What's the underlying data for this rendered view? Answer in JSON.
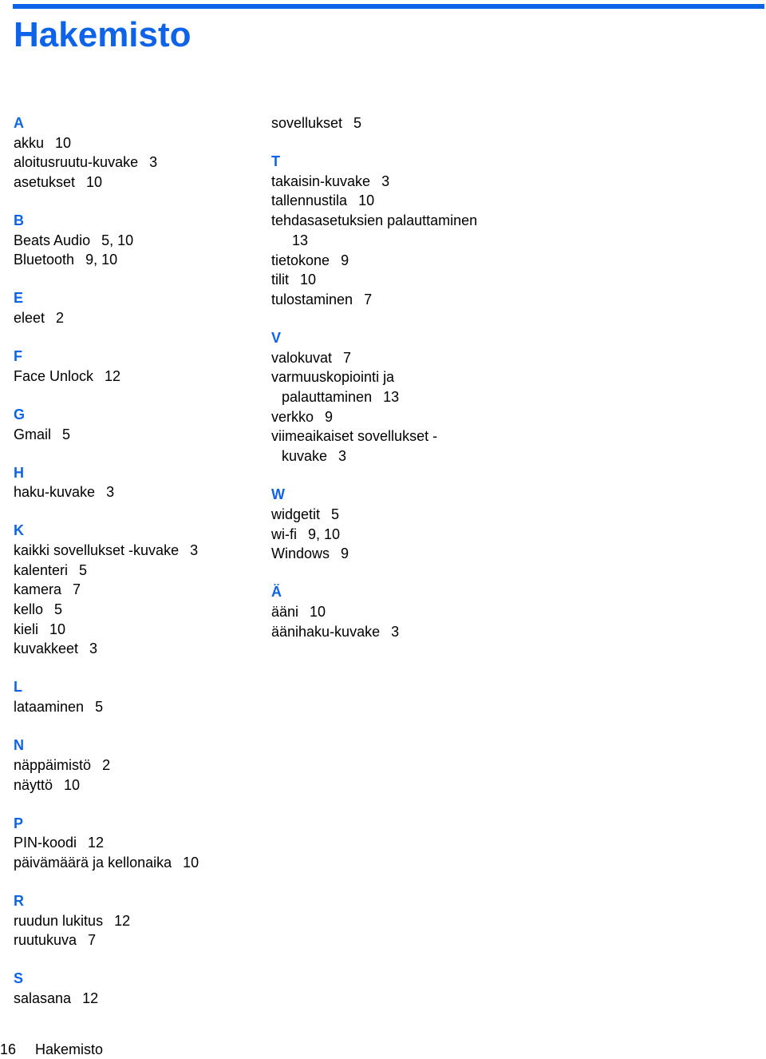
{
  "page": {
    "title": "Hakemisto",
    "accent_color": "#0d64e8"
  },
  "columns": [
    {
      "sections": [
        {
          "letter": "A",
          "entries": [
            {
              "term": "akku",
              "pages": "10"
            },
            {
              "term": "aloitusruutu-kuvake",
              "pages": "3"
            },
            {
              "term": "asetukset",
              "pages": "10"
            }
          ]
        },
        {
          "letter": "B",
          "entries": [
            {
              "term": "Beats Audio",
              "pages": "5, 10"
            },
            {
              "term": "Bluetooth",
              "pages": "9, 10"
            }
          ]
        },
        {
          "letter": "E",
          "entries": [
            {
              "term": "eleet",
              "pages": "2"
            }
          ]
        },
        {
          "letter": "F",
          "entries": [
            {
              "term": "Face Unlock",
              "pages": "12"
            }
          ]
        },
        {
          "letter": "G",
          "entries": [
            {
              "term": "Gmail",
              "pages": "5"
            }
          ]
        },
        {
          "letter": "H",
          "entries": [
            {
              "term": "haku-kuvake",
              "pages": "3"
            }
          ]
        },
        {
          "letter": "K",
          "entries": [
            {
              "term": "kaikki sovellukset -kuvake",
              "pages": "3"
            },
            {
              "term": "kalenteri",
              "pages": "5"
            },
            {
              "term": "kamera",
              "pages": "7"
            },
            {
              "term": "kello",
              "pages": "5"
            },
            {
              "term": "kieli",
              "pages": "10"
            },
            {
              "term": "kuvakkeet",
              "pages": "3"
            }
          ]
        },
        {
          "letter": "L",
          "entries": [
            {
              "term": "lataaminen",
              "pages": "5"
            }
          ]
        },
        {
          "letter": "N",
          "entries": [
            {
              "term": "näppäimistö",
              "pages": "2"
            },
            {
              "term": "näyttö",
              "pages": "10"
            }
          ]
        },
        {
          "letter": "P",
          "entries": [
            {
              "term": "PIN-koodi",
              "pages": "12"
            },
            {
              "term": "päivämäärä ja kellonaika",
              "pages": "10"
            }
          ]
        },
        {
          "letter": "R",
          "entries": [
            {
              "term": "ruudun lukitus",
              "pages": "12"
            },
            {
              "term": "ruutukuva",
              "pages": "7"
            }
          ]
        },
        {
          "letter": "S",
          "entries": [
            {
              "term": "salasana",
              "pages": "12"
            }
          ]
        }
      ]
    },
    {
      "continued_entries": [
        {
          "term": "sovellukset",
          "pages": "5"
        }
      ],
      "sections": [
        {
          "letter": "T",
          "entries": [
            {
              "term": "takaisin-kuvake",
              "pages": "3"
            },
            {
              "term": "tallennustila",
              "pages": "10"
            },
            {
              "term": "tehdasasetuksien palauttaminen",
              "pages": "13"
            },
            {
              "term": "tietokone",
              "pages": "9"
            },
            {
              "term": "tilit",
              "pages": "10"
            },
            {
              "term": "tulostaminen",
              "pages": "7"
            }
          ]
        },
        {
          "letter": "V",
          "entries": [
            {
              "term": "valokuvat",
              "pages": "7"
            },
            {
              "term": "varmuuskopiointi ja palauttaminen",
              "pages": "13"
            },
            {
              "term": "verkko",
              "pages": "9"
            },
            {
              "term": "viimeaikaiset sovellukset -kuvake",
              "pages": "3"
            }
          ]
        },
        {
          "letter": "W",
          "entries": [
            {
              "term": "widgetit",
              "pages": "5"
            },
            {
              "term": "wi-fi",
              "pages": "9, 10"
            },
            {
              "term": "Windows",
              "pages": "9"
            }
          ]
        },
        {
          "letter": "Ä",
          "entries": [
            {
              "term": "ääni",
              "pages": "10"
            },
            {
              "term": "äänihaku-kuvake",
              "pages": "3"
            }
          ]
        }
      ]
    }
  ],
  "footer": {
    "page_number": "16",
    "section_title": "Hakemisto"
  }
}
